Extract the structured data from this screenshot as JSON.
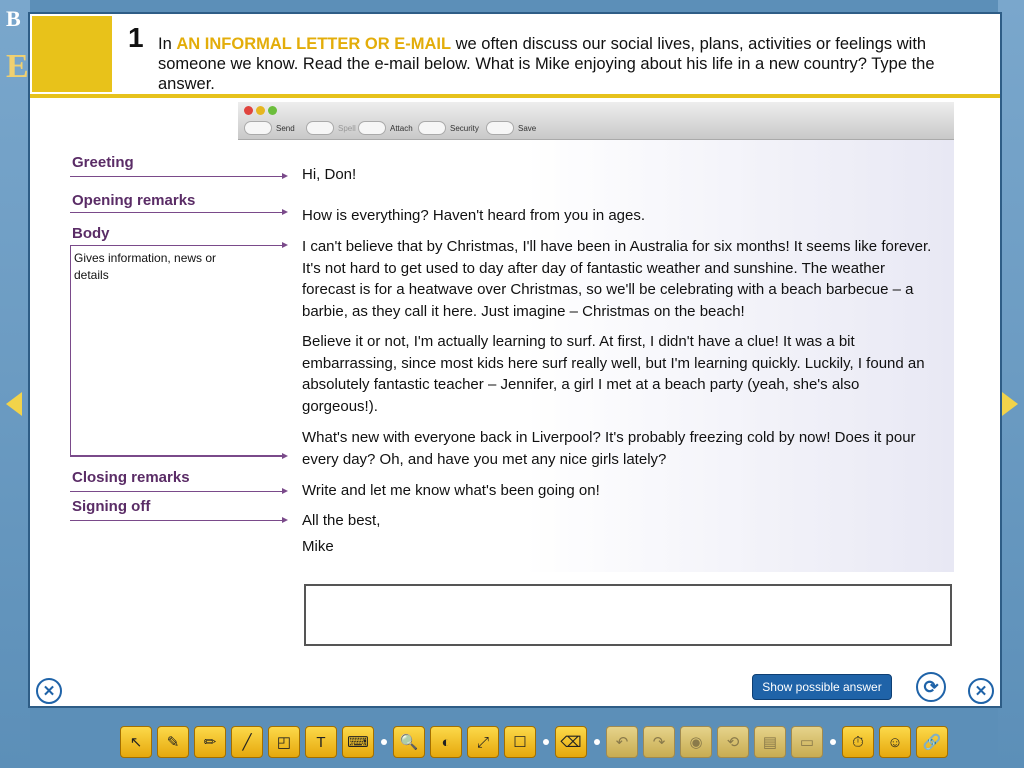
{
  "question": {
    "number": "1",
    "text_before": "In ",
    "highlight": "AN INFORMAL LETTER OR E-MAIL",
    "text_after": " we often discuss our social lives, plans, activities or feelings with someone we know. Read the e-mail below. What is Mike enjoying about his life in a new country? Type the answer."
  },
  "mail_toolbar": {
    "send": "Send",
    "spell": "Spell",
    "attach": "Attach",
    "security": "Security",
    "save": "Save"
  },
  "labels": {
    "greeting": "Greeting",
    "opening": "Opening remarks",
    "body": "Body",
    "body_sub": "Gives information, news or details",
    "closing": "Closing remarks",
    "signing": "Signing off"
  },
  "email": {
    "greeting": "Hi, Don!",
    "opening": "How is everything? Haven't heard from you in ages.",
    "para1": "I can't believe that by Christmas, I'll have been in Australia for six months! It seems like forever.  It's not hard to get used to day after day of fantastic weather and sunshine. The weather forecast is for a heatwave over Christmas, so we'll be celebrating with a beach barbecue – a barbie, as they call it here. Just imagine – Christmas on the beach!",
    "para2": "Believe it or not, I'm actually learning to surf. At first, I didn't have a clue! It was a bit embarrassing, since most kids here surf really well, but I'm learning quickly. Luckily, I found an absolutely fantastic teacher – Jennifer, a girl I met at a beach party (yeah, she's also gorgeous!).",
    "para3": "What's new with everyone back in Liverpool? It's probably freezing cold by now! Does it pour every day? Oh, and have you met any nice girls lately?",
    "closing": "Write and let me know what's been going on!",
    "signoff1": "All the best,",
    "signoff2": "Mike"
  },
  "answer": {
    "value": ""
  },
  "buttons": {
    "show_answer": "Show possible answer"
  },
  "background": {
    "letter_b": "B",
    "letter_e": "E"
  },
  "colors": {
    "accent_yellow": "#e8c21a",
    "highlight_text": "#e3ad0a",
    "label_purple": "#5a2c66",
    "button_blue": "#1f63a8"
  },
  "bottom_tools": [
    {
      "icon": "pointer-icon",
      "glyph": "↖",
      "enabled": true
    },
    {
      "icon": "pen-icon",
      "glyph": "✎",
      "enabled": true
    },
    {
      "icon": "highlighter-icon",
      "glyph": "✏",
      "enabled": true
    },
    {
      "icon": "line-icon",
      "glyph": "╱",
      "enabled": true
    },
    {
      "icon": "shapes-icon",
      "glyph": "◰",
      "enabled": true
    },
    {
      "icon": "text-icon",
      "glyph": "T",
      "enabled": true
    },
    {
      "icon": "keyboard-icon",
      "glyph": "⌨",
      "enabled": true
    },
    {
      "icon": "magnifier-icon",
      "glyph": "🔍",
      "enabled": true
    },
    {
      "icon": "spotlight-icon",
      "glyph": "◐",
      "enabled": true
    },
    {
      "icon": "fullscreen-icon",
      "glyph": "⤢",
      "enabled": true
    },
    {
      "icon": "whiteboard-icon",
      "glyph": "☐",
      "enabled": true
    },
    {
      "icon": "eraser-icon",
      "glyph": "⌫",
      "enabled": true
    },
    {
      "icon": "undo-icon",
      "glyph": "↶",
      "enabled": false
    },
    {
      "icon": "redo-icon",
      "glyph": "↷",
      "enabled": false
    },
    {
      "icon": "eye-icon",
      "glyph": "◉",
      "enabled": false
    },
    {
      "icon": "reset-icon",
      "glyph": "⟲",
      "enabled": false
    },
    {
      "icon": "save-icon",
      "glyph": "▤",
      "enabled": false
    },
    {
      "icon": "folder-icon",
      "glyph": "▭",
      "enabled": false
    },
    {
      "icon": "timer-icon",
      "glyph": "⏱",
      "enabled": true
    },
    {
      "icon": "users-icon",
      "glyph": "☺",
      "enabled": true
    },
    {
      "icon": "link-icon",
      "glyph": "🔗",
      "enabled": true
    }
  ]
}
